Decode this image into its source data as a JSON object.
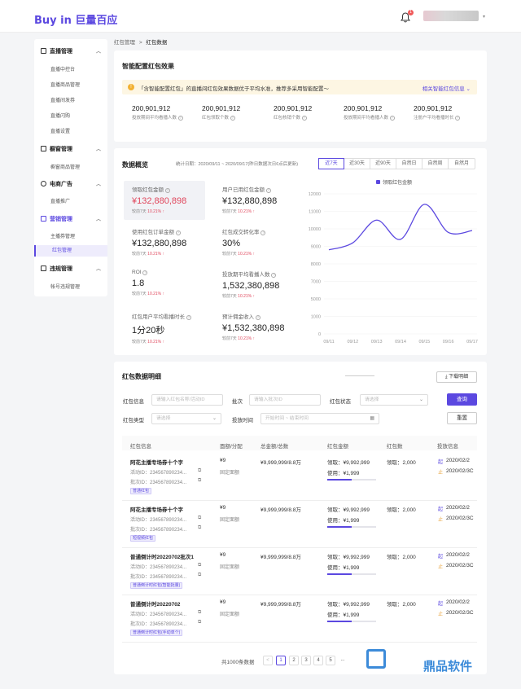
{
  "app": {
    "logo": "Buy in 巨量百应",
    "notification_count": "1"
  },
  "sidebar": {
    "groups": [
      {
        "label": "直播管理",
        "items": [
          "直播中控台",
          "直播商品管理",
          "直播间发券",
          "直播闪购",
          "直播设置"
        ]
      },
      {
        "label": "橱窗管理",
        "items": [
          "橱窗商品管理"
        ]
      },
      {
        "label": "电商广告",
        "items": [
          "直播推广"
        ]
      },
      {
        "label": "营销管理",
        "items": [
          "主播券管理",
          "红包管理"
        ]
      },
      {
        "label": "违规管理",
        "items": [
          "帐号违规管理"
        ]
      }
    ],
    "active_item": "红包管理"
  },
  "breadcrumb": {
    "parent": "红包管理",
    "sep": ">",
    "current": "红包数据"
  },
  "effect": {
    "title": "智能配置红包效果",
    "notice": "「含智能配置红包」的直播间红包效果数据优于平均水准，推荐多采用智能配置～",
    "notice_link": "相关智能红包信息 ⌄",
    "stats": [
      {
        "value": "200,901,912",
        "label": "投放期间平均看播人数"
      },
      {
        "value": "200,901,912",
        "label": "红包领取个数"
      },
      {
        "value": "200,901,912",
        "label": "红包核销个数"
      },
      {
        "value": "200,901,912",
        "label": "投放期间平均看播人数"
      },
      {
        "value": "200,901,912",
        "label": "注册户平均看播时长"
      }
    ]
  },
  "overview": {
    "title": "数据概览",
    "date_text": "统计日期：2020/09/11 ~ 2020/09/17(昨日数据次日6点后更新)",
    "tabs": [
      "近7天",
      "近30天",
      "近90天",
      "自然日",
      "自然周",
      "自然月"
    ],
    "active_tab": "近7天",
    "metrics": [
      {
        "label": "领取红包金额",
        "value": "¥132,880,898",
        "compare": "较前7天",
        "rate": "10.21% ↑"
      },
      {
        "label": "用户已用红包金额",
        "value": "¥132,880,898",
        "compare": "较前7天",
        "rate": "10.21% ↑"
      },
      {
        "label": "使用红包订单金额",
        "value": "¥132,880,898",
        "compare": "较前7天",
        "rate": "10.21% ↑"
      },
      {
        "label": "红包成交转化率",
        "value": "30%",
        "compare": "较前7天",
        "rate": "10.21% ↑"
      },
      {
        "label": "ROI",
        "value": "1.8",
        "compare": "较前7天",
        "rate": "10.21% ↑"
      },
      {
        "label": "投放期平均看播人数",
        "value": "1,532,380,898",
        "compare": "较前7天",
        "rate": "10.21% ↑"
      },
      {
        "label": "红包用户平均看播时长",
        "value": "1分20秒",
        "compare": "较前7天",
        "rate": "10.21% ↑"
      },
      {
        "label": "预计佣金收入",
        "value": "¥1,532,380,898",
        "compare": "较前7天",
        "rate": "10.21% ↑"
      }
    ]
  },
  "chart_data": {
    "type": "line",
    "legend": "领取红包金额",
    "x": [
      "09/11",
      "09/12",
      "09/13",
      "09/14",
      "09/15",
      "09/16",
      "09/17"
    ],
    "y_ticks": [
      0,
      1000,
      5000,
      7000,
      8000,
      9000,
      10000,
      11000,
      12000
    ],
    "values": [
      8800,
      9200,
      10500,
      9400,
      11400,
      9800,
      9900
    ],
    "color": "#5b48e0"
  },
  "detail": {
    "title": "红包数据明细",
    "download": "下载明细",
    "filters": {
      "info_label": "红包信息",
      "info_placeholder": "请输入红包名称/活动ID",
      "batch_label": "批次",
      "batch_placeholder": "请输入批次ID",
      "status_label": "红包状态",
      "status_placeholder": "请选择",
      "type_label": "红包类型",
      "type_placeholder": "请选择",
      "time_label": "投放时间",
      "time_placeholder": "开始时间 ~ 结束时间",
      "query": "查询",
      "reset": "重置"
    },
    "columns": [
      "红包信息",
      "面额/分配",
      "总金额/总数",
      "红包金额",
      "红包数",
      "投放信息"
    ],
    "rows": [
      {
        "name": "阿花主播专场券十个字",
        "act": "活动ID：234567890234...",
        "batch": "批次ID：234567890234...",
        "tag": "普通红包",
        "denom": "¥9",
        "alloc": "固定面额",
        "total": "¥9,999,999/8.8万",
        "claim": "领取：¥9,992,999",
        "use": "使用：¥1,999",
        "count": "领取：2,000",
        "start": "2020/02/2",
        "end": "2020/02/3C"
      },
      {
        "name": "阿花主播专场券十个字",
        "act": "活动ID：234567890234...",
        "batch": "批次ID：234567890234...",
        "tag": "短视频红包",
        "denom": "¥9",
        "alloc": "固定面额",
        "total": "¥9,999,999/8.8万",
        "claim": "领取：¥9,992,999",
        "use": "使用：¥1,999",
        "count": "领取：2,000",
        "start": "2020/02/2",
        "end": "2020/02/3C"
      },
      {
        "name": "普通倒计时20220702批次1",
        "act": "活动ID：234567890234...",
        "batch": "批次ID：234567890234...",
        "tag": "普通倒计时红包(智能批量)",
        "denom": "¥9",
        "alloc": "固定面额",
        "total": "¥9,999,999/8.8万",
        "claim": "领取：¥9,992,999",
        "use": "使用：¥1,999",
        "count": "领取：2,000",
        "start": "2020/02/2",
        "end": "2020/02/3C"
      },
      {
        "name": "普通倒计时20220702",
        "act": "活动ID：234567890234...",
        "batch": "批次ID：234567890234...",
        "tag": "普通倒计时红包(手动单个)",
        "denom": "¥9",
        "alloc": "固定面额",
        "total": "¥9,999,999/8.8万",
        "claim": "领取：¥9,992,999",
        "use": "使用：¥1,999",
        "count": "领取：2,000",
        "start": "2020/02/2",
        "end": "2020/02/3C"
      }
    ],
    "total_text": "共1000条数据",
    "pages": [
      "<",
      "1",
      "2",
      "3",
      "4",
      "5",
      "..."
    ]
  },
  "watermark": "鼎品软件"
}
